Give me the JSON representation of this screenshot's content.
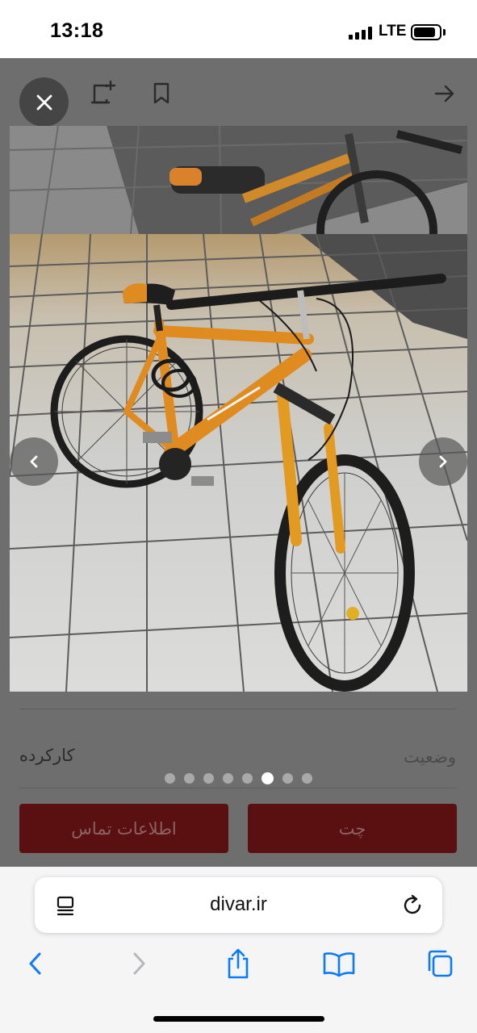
{
  "status_bar": {
    "time": "13:18",
    "network": "LTE",
    "battery_level": 0.85,
    "signal_bars": 4
  },
  "gallery": {
    "close_icon": "close-icon",
    "top_icons": [
      "add-note-icon",
      "bookmark-icon",
      "arrow-right-icon"
    ],
    "photo_subject": "bicycle-photo",
    "prev_icon": "chevron-left-icon",
    "next_icon": "chevron-right-icon",
    "dot_count": 8,
    "active_dot": 6
  },
  "details": {
    "condition_label": "وضعیت",
    "condition_value": "کارکرده"
  },
  "actions": {
    "contact_label": "اطلاعات تماس",
    "chat_label": "چت"
  },
  "browser": {
    "url": "divar.ir",
    "reader_icon": "reader-icon",
    "reload_icon": "reload-icon",
    "toolbar_icons": [
      "back-icon",
      "forward-icon",
      "share-icon",
      "bookmarks-icon",
      "tabs-icon"
    ]
  },
  "colors": {
    "overlay": "#6e6e6e",
    "button_dim": "#5a1010",
    "accent_blue": "#0a7aff"
  }
}
